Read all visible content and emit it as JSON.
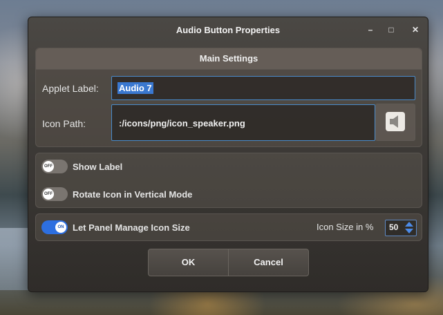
{
  "window": {
    "title": "Audio Button Properties",
    "minimize": "–",
    "maximize": "□",
    "close": "✕"
  },
  "main_settings": {
    "header": "Main Settings",
    "applet_label_label": "Applet Label:",
    "applet_label_value": "Audio 7",
    "icon_path_label": "Icon Path:",
    "icon_path_value": ":/icons/png/icon_speaker.png",
    "icon_preview": "speaker-icon"
  },
  "toggles": {
    "show_label": {
      "label": "Show Label",
      "state": "OFF"
    },
    "rotate_icon": {
      "label": "Rotate Icon in Vertical Mode",
      "state": "OFF"
    },
    "panel_manage": {
      "label": "Let Panel Manage Icon Size",
      "state": "ON"
    }
  },
  "icon_size": {
    "label": "Icon Size in %",
    "value": "50"
  },
  "buttons": {
    "ok": "OK",
    "cancel": "Cancel"
  },
  "colors": {
    "accent": "#2d6fe0",
    "focus_border": "#4a8ccc",
    "selection": "#3a78d0"
  }
}
